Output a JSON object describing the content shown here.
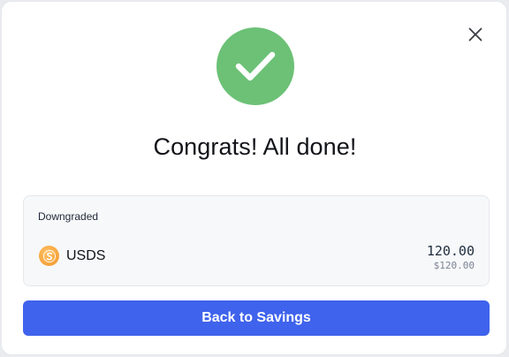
{
  "modal": {
    "title": "Congrats! All done!",
    "close_icon": "close-icon",
    "success_icon": "check-icon",
    "success_color": "#6cc176"
  },
  "card": {
    "label": "Downgraded",
    "token": {
      "symbol": "USDS",
      "icon": "usds-token-icon",
      "amount": "120.00",
      "amount_usd": "$120.00"
    }
  },
  "actions": {
    "back_label": "Back to Savings",
    "button_color": "#3f63ec"
  }
}
